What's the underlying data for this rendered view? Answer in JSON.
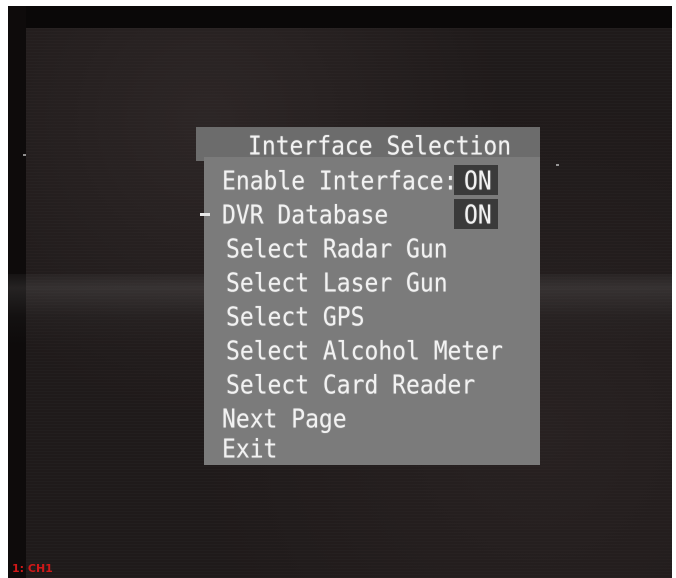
{
  "menu": {
    "title": "Interface Selection",
    "items": [
      {
        "label": "Enable Interface:",
        "value": "ON"
      },
      {
        "label": "DVR Database",
        "value": "ON"
      },
      {
        "label": "Select Radar Gun"
      },
      {
        "label": "Select Laser Gun"
      },
      {
        "label": "Select GPS"
      },
      {
        "label": "Select Alcohol Meter"
      },
      {
        "label": "Select Card Reader"
      },
      {
        "label": "Next Page"
      },
      {
        "label": "Exit"
      }
    ],
    "selected_item": "DVR Database"
  },
  "channel_label": "1: CH1",
  "colors": {
    "menu_header": "#6c6c6c",
    "menu_body": "#7b7b7b",
    "value_highlight": "#3a3a3a",
    "text": "#f2f2f2",
    "channel_label": "#d01818"
  }
}
